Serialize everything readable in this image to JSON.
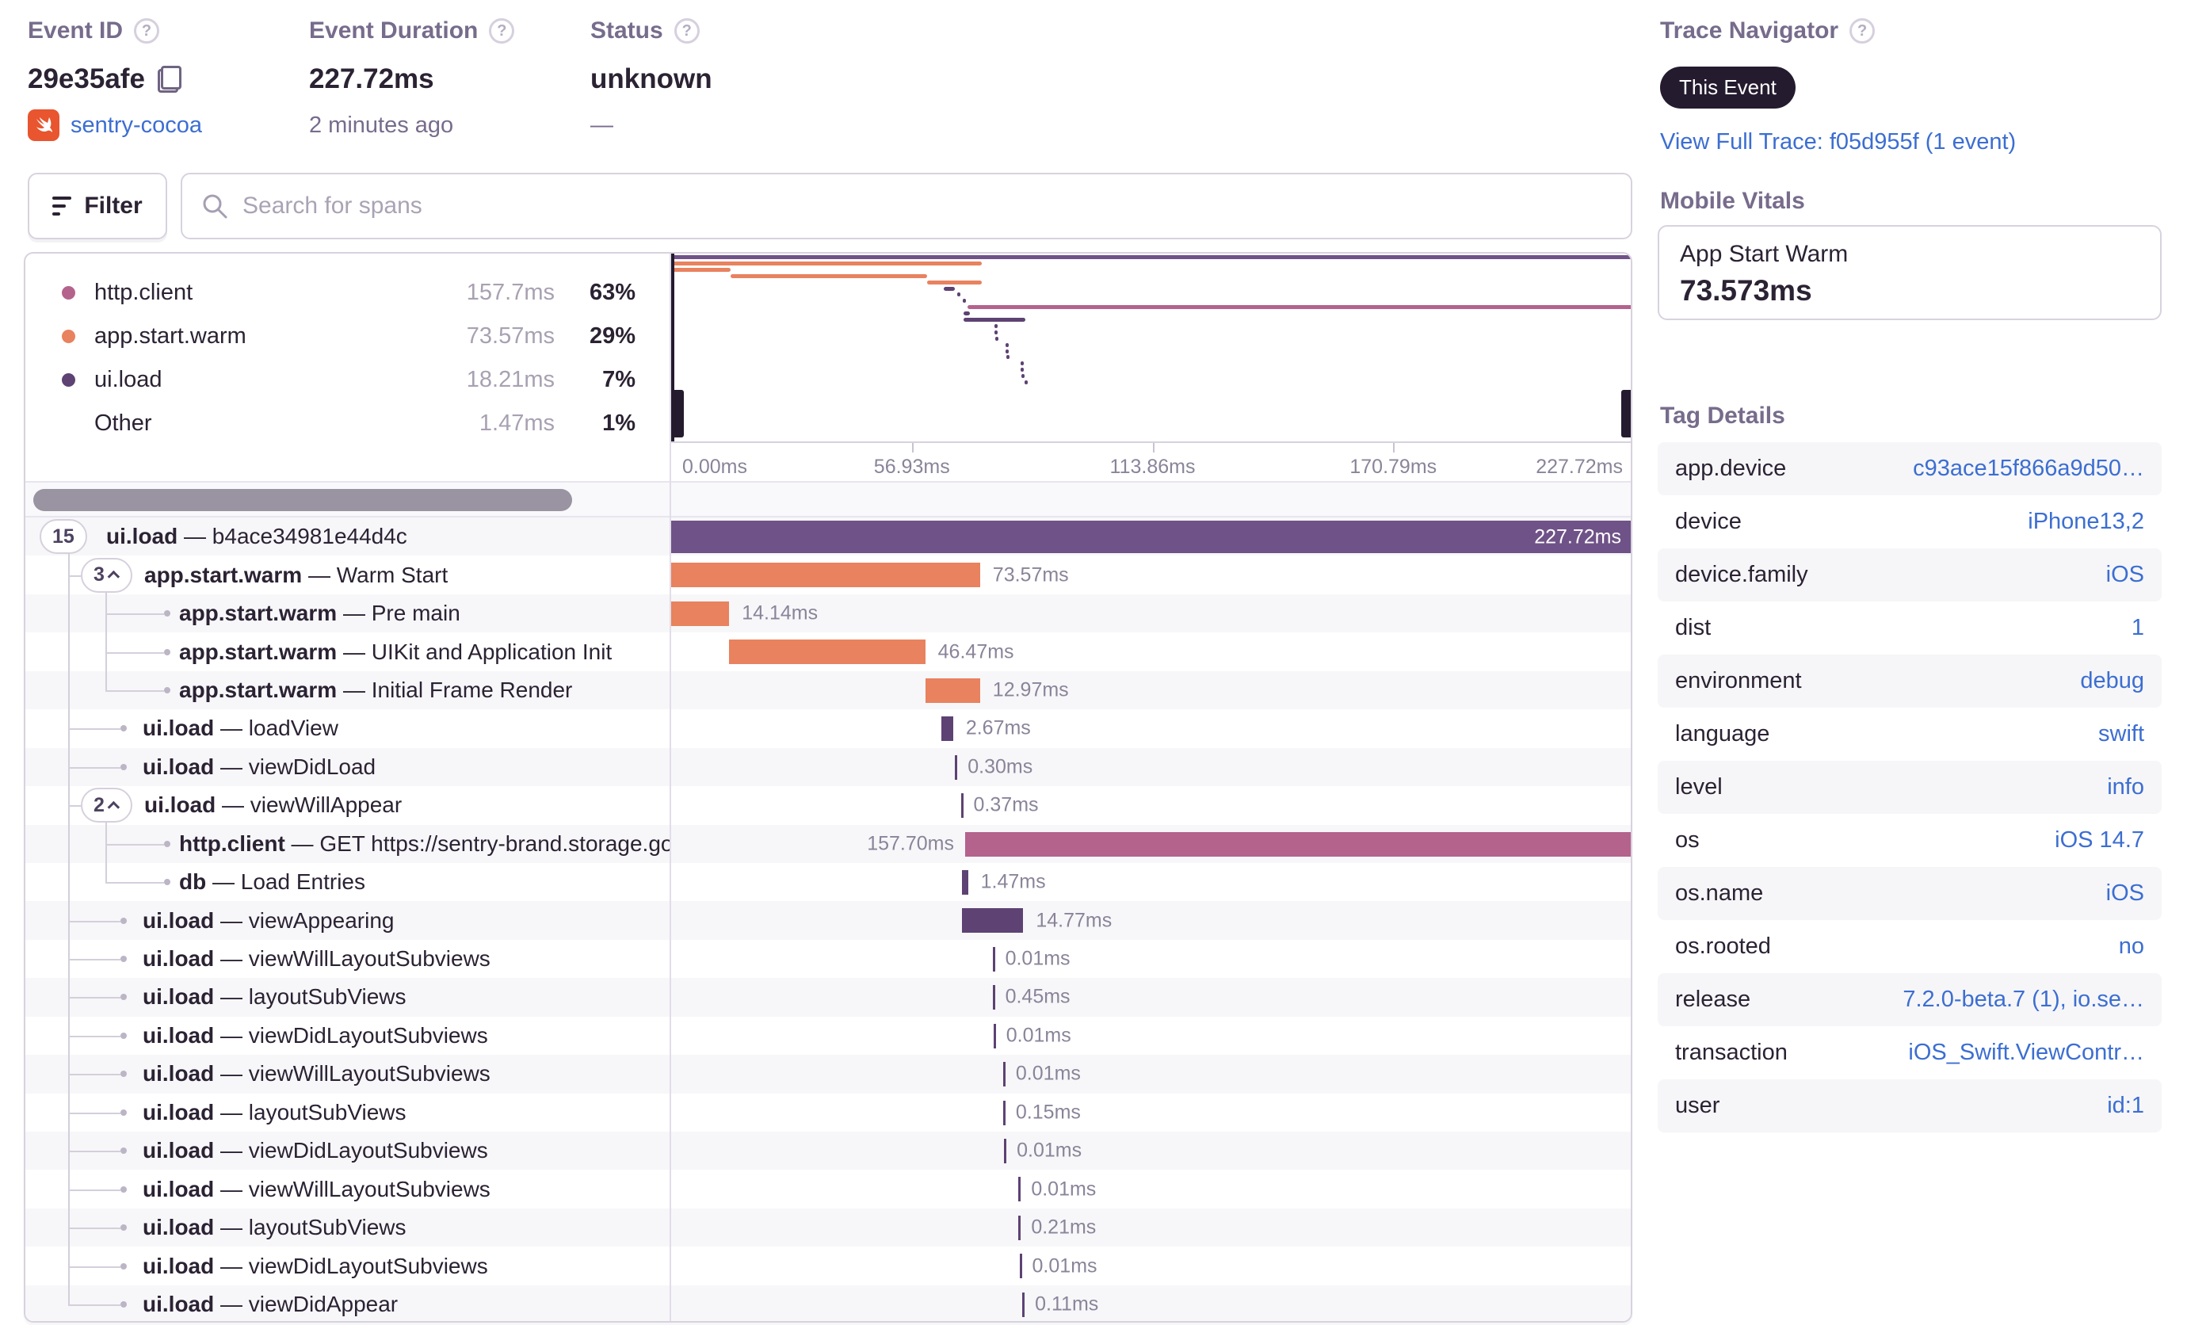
{
  "colors": {
    "orange": "#e8825f",
    "pink": "#b4638d",
    "purple": "#5d4273",
    "purple_root": "#6f5287",
    "link_blue": "#3c6ed2",
    "zebra": "#f7f7f9"
  },
  "header": {
    "event_id": {
      "label": "Event ID",
      "value": "29e35afe",
      "project": "sentry-cocoa"
    },
    "event_duration": {
      "label": "Event Duration",
      "value": "227.72ms",
      "ago": "2 minutes ago"
    },
    "status": {
      "label": "Status",
      "value": "unknown",
      "sub": "—"
    }
  },
  "trace_navigator": {
    "label": "Trace Navigator",
    "badge": "This Event",
    "link": "View Full Trace: f05d955f (1 event)"
  },
  "toolbar": {
    "filter_label": "Filter",
    "search_placeholder": "Search for spans"
  },
  "legend": {
    "items": [
      {
        "name": "http.client",
        "duration": "157.7ms",
        "pct": "63%",
        "color": "#b4638d"
      },
      {
        "name": "app.start.warm",
        "duration": "73.57ms",
        "pct": "29%",
        "color": "#e8825f"
      },
      {
        "name": "ui.load",
        "duration": "18.21ms",
        "pct": "7%",
        "color": "#5d4273"
      },
      {
        "name": "Other",
        "duration": "1.47ms",
        "pct": "1%",
        "color": null
      }
    ]
  },
  "axis": {
    "ticks": [
      "0.00ms",
      "56.93ms",
      "113.86ms",
      "170.79ms",
      "227.72ms"
    ]
  },
  "separator": "—",
  "spans": {
    "rows": [
      {
        "op": "ui.load",
        "desc": "b4ace34981e44d4c",
        "badge": "15",
        "chevron": false,
        "level": 0,
        "duration": "227.72ms",
        "bar": {
          "start": 0,
          "width": 100,
          "color": "purple_root",
          "label_pos": "inside"
        }
      },
      {
        "op": "app.start.warm",
        "desc": "Warm Start",
        "badge": "3",
        "chevron": true,
        "level": 1,
        "duration": "73.57ms",
        "bar": {
          "start": 0,
          "width": 32.3,
          "color": "orange",
          "label_pos": "right"
        }
      },
      {
        "op": "app.start.warm",
        "desc": "Pre main",
        "badge": null,
        "level": 2,
        "duration": "14.14ms",
        "bar": {
          "start": 0,
          "width": 6.2,
          "color": "orange",
          "label_pos": "right"
        }
      },
      {
        "op": "app.start.warm",
        "desc": "UIKit and Application Init",
        "badge": null,
        "level": 2,
        "duration": "46.47ms",
        "bar": {
          "start": 6.2,
          "width": 20.4,
          "color": "orange",
          "label_pos": "right"
        }
      },
      {
        "op": "app.start.warm",
        "desc": "Initial Frame Render",
        "badge": null,
        "level": 2,
        "duration": "12.97ms",
        "bar": {
          "start": 26.6,
          "width": 5.7,
          "color": "orange",
          "label_pos": "right"
        }
      },
      {
        "op": "ui.load",
        "desc": "loadView",
        "badge": null,
        "level": 1,
        "duration": "2.67ms",
        "bar": {
          "start": 28.3,
          "width": 1.2,
          "color": "purple",
          "label_pos": "right"
        }
      },
      {
        "op": "ui.load",
        "desc": "viewDidLoad",
        "badge": null,
        "level": 1,
        "duration": "0.30ms",
        "bar": {
          "start": 29.7,
          "width": 0.15,
          "color": "purple",
          "label_pos": "right"
        }
      },
      {
        "op": "ui.load",
        "desc": "viewWillAppear",
        "badge": "2",
        "chevron": true,
        "level": 1,
        "duration": "0.37ms",
        "bar": {
          "start": 30.3,
          "width": 0.15,
          "color": "purple",
          "label_pos": "right"
        }
      },
      {
        "op": "http.client",
        "desc": "GET https://sentry-brand.storage.googlea",
        "badge": null,
        "level": 2,
        "duration": "157.70ms",
        "bar": {
          "start": 30.75,
          "width": 69.25,
          "color": "pink",
          "label_pos": "left"
        }
      },
      {
        "op": "db",
        "desc": "Load Entries",
        "badge": null,
        "level": 2,
        "duration": "1.47ms",
        "bar": {
          "start": 30.4,
          "width": 0.65,
          "color": "purple",
          "label_pos": "right"
        }
      },
      {
        "op": "ui.load",
        "desc": "viewAppearing",
        "badge": null,
        "level": 1,
        "duration": "14.77ms",
        "bar": {
          "start": 30.4,
          "width": 6.4,
          "color": "purple",
          "label_pos": "right"
        }
      },
      {
        "op": "ui.load",
        "desc": "viewWillLayoutSubviews",
        "badge": null,
        "level": 1,
        "duration": "0.01ms",
        "bar": {
          "start": 33.6,
          "width": 0.15,
          "color": "purple",
          "label_pos": "right"
        }
      },
      {
        "op": "ui.load",
        "desc": "layoutSubViews",
        "badge": null,
        "level": 1,
        "duration": "0.45ms",
        "bar": {
          "start": 33.6,
          "width": 0.15,
          "color": "purple",
          "label_pos": "right"
        }
      },
      {
        "op": "ui.load",
        "desc": "viewDidLayoutSubviews",
        "badge": null,
        "level": 1,
        "duration": "0.01ms",
        "bar": {
          "start": 33.7,
          "width": 0.15,
          "color": "purple",
          "label_pos": "right"
        }
      },
      {
        "op": "ui.load",
        "desc": "viewWillLayoutSubviews",
        "badge": null,
        "level": 1,
        "duration": "0.01ms",
        "bar": {
          "start": 34.7,
          "width": 0.15,
          "color": "purple",
          "label_pos": "right"
        }
      },
      {
        "op": "ui.load",
        "desc": "layoutSubViews",
        "badge": null,
        "level": 1,
        "duration": "0.15ms",
        "bar": {
          "start": 34.7,
          "width": 0.15,
          "color": "purple",
          "label_pos": "right"
        }
      },
      {
        "op": "ui.load",
        "desc": "viewDidLayoutSubviews",
        "badge": null,
        "level": 1,
        "duration": "0.01ms",
        "bar": {
          "start": 34.8,
          "width": 0.15,
          "color": "purple",
          "label_pos": "right"
        }
      },
      {
        "op": "ui.load",
        "desc": "viewWillLayoutSubviews",
        "badge": null,
        "level": 1,
        "duration": "0.01ms",
        "bar": {
          "start": 36.3,
          "width": 0.15,
          "color": "purple",
          "label_pos": "right"
        }
      },
      {
        "op": "ui.load",
        "desc": "layoutSubViews",
        "badge": null,
        "level": 1,
        "duration": "0.21ms",
        "bar": {
          "start": 36.3,
          "width": 0.15,
          "color": "purple",
          "label_pos": "right"
        }
      },
      {
        "op": "ui.load",
        "desc": "viewDidLayoutSubviews",
        "badge": null,
        "level": 1,
        "duration": "0.01ms",
        "bar": {
          "start": 36.4,
          "width": 0.15,
          "color": "purple",
          "label_pos": "right"
        }
      },
      {
        "op": "ui.load",
        "desc": "viewDidAppear",
        "badge": null,
        "level": 1,
        "duration": "0.11ms",
        "bar": {
          "start": 36.7,
          "width": 0.15,
          "color": "purple",
          "label_pos": "right"
        }
      }
    ]
  },
  "mobile_vitals": {
    "heading": "Mobile Vitals",
    "metric_name": "App Start Warm",
    "metric_value": "73.573ms"
  },
  "tag_details": {
    "heading": "Tag Details",
    "rows": [
      {
        "key": "app.device",
        "value": "c93ace15f866a9d50…"
      },
      {
        "key": "device",
        "value": "iPhone13,2"
      },
      {
        "key": "device.family",
        "value": "iOS"
      },
      {
        "key": "dist",
        "value": "1"
      },
      {
        "key": "environment",
        "value": "debug"
      },
      {
        "key": "language",
        "value": "swift"
      },
      {
        "key": "level",
        "value": "info"
      },
      {
        "key": "os",
        "value": "iOS 14.7"
      },
      {
        "key": "os.name",
        "value": "iOS"
      },
      {
        "key": "os.rooted",
        "value": "no"
      },
      {
        "key": "release",
        "value": "7.2.0-beta.7 (1), io.se…"
      },
      {
        "key": "transaction",
        "value": "iOS_Swift.ViewContr…"
      },
      {
        "key": "user",
        "value": "id:1"
      }
    ]
  },
  "icons": {
    "question": "?",
    "copy": "copy-icon",
    "search": "search-icon",
    "filter": "filter-icon",
    "swift": "swift-project-icon"
  }
}
